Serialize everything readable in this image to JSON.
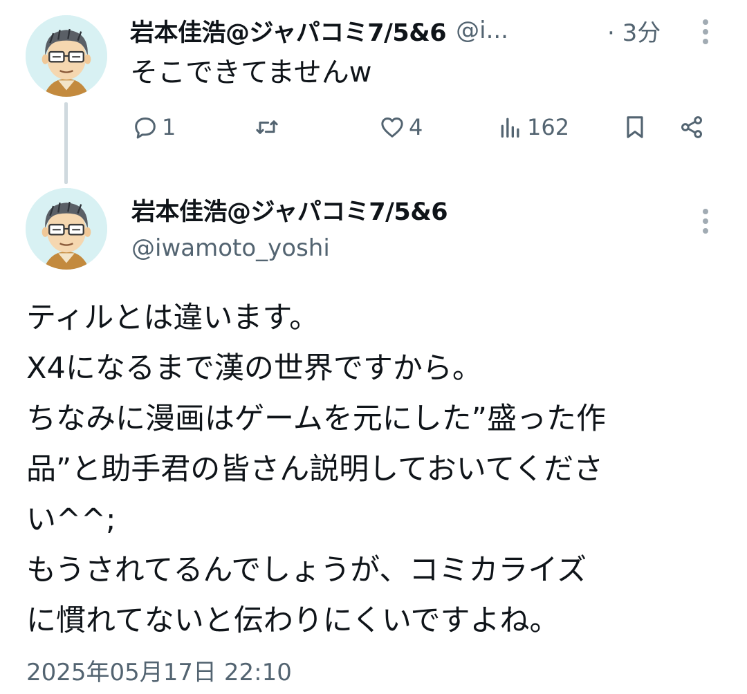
{
  "reply": {
    "author_name": "岩本佳浩@ジャパコミ7/5&6",
    "author_handle_truncated": "@i...",
    "time": "· 3分",
    "text": "そこできてませんw",
    "stats": {
      "replies": "1",
      "likes": "4",
      "views": "162"
    }
  },
  "main": {
    "author_name": "岩本佳浩@ジャパコミ7/5&6",
    "author_handle": "@iwamoto_yoshi",
    "lines": [
      "ティルとは違います。",
      "X4になるまで漢の世界ですから。",
      "ちなみに漫画はゲームを元にした”盛った作",
      "品”と助手君の皆さん説明しておいてくださ",
      "い^^;",
      "もうされてるんでしょうが、コミカライズ",
      "に慣れてないと伝わりにくいですよね。"
    ],
    "timestamp": "2025年05月17日 22:10"
  },
  "icons": {
    "reply": "speech-bubble-icon",
    "retweet": "retweet-icon",
    "like": "heart-icon",
    "views": "bar-chart-icon",
    "bookmark": "bookmark-icon",
    "share": "share-icon",
    "more": "more-vertical-icon"
  },
  "colors": {
    "text": "#0f1419",
    "secondary": "#536471",
    "thread_line": "#cfd9de",
    "avatar_bg": "#d8f1f3"
  }
}
